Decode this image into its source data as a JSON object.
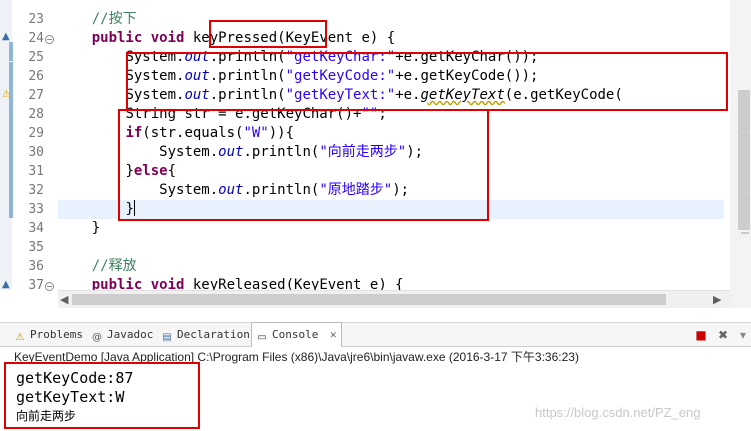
{
  "editor": {
    "line_numbers": [
      "23",
      "24",
      "25",
      "26",
      "27",
      "28",
      "29",
      "30",
      "31",
      "32",
      "33",
      "34",
      "35",
      "36",
      "37"
    ],
    "lines": [
      {
        "indent": "    ",
        "parts": [
          {
            "t": "//按下",
            "c": "cm"
          }
        ]
      },
      {
        "indent": "    ",
        "parts": [
          {
            "t": "public",
            "c": "kw"
          },
          {
            "t": " "
          },
          {
            "t": "void",
            "c": "kw"
          },
          {
            "t": " keyPressed(KeyEvent e) {"
          }
        ]
      },
      {
        "indent": "        ",
        "parts": [
          {
            "t": "System."
          },
          {
            "t": "out",
            "c": "it"
          },
          {
            "t": ".println("
          },
          {
            "t": "\"getKeyChar:\"",
            "c": "st"
          },
          {
            "t": "+e.getKeyChar());"
          }
        ]
      },
      {
        "indent": "        ",
        "parts": [
          {
            "t": "System."
          },
          {
            "t": "out",
            "c": "it"
          },
          {
            "t": ".println("
          },
          {
            "t": "\"getKeyCode:\"",
            "c": "st"
          },
          {
            "t": "+e.getKeyCode());"
          }
        ]
      },
      {
        "indent": "        ",
        "parts": [
          {
            "t": "System."
          },
          {
            "t": "out",
            "c": "it"
          },
          {
            "t": ".println("
          },
          {
            "t": "\"getKeyText:\"",
            "c": "st"
          },
          {
            "t": "+e."
          },
          {
            "t": "getKeyText",
            "c": "mi squig"
          },
          {
            "t": "(e.getKeyCode("
          }
        ]
      },
      {
        "indent": "        ",
        "parts": [
          {
            "t": "String str = e.getKeyChar()+"
          },
          {
            "t": "\"\"",
            "c": "st"
          },
          {
            "t": ";"
          }
        ]
      },
      {
        "indent": "        ",
        "parts": [
          {
            "t": "if",
            "c": "kw"
          },
          {
            "t": "(str.equals("
          },
          {
            "t": "\"W\"",
            "c": "st"
          },
          {
            "t": ")){"
          }
        ]
      },
      {
        "indent": "            ",
        "parts": [
          {
            "t": "System."
          },
          {
            "t": "out",
            "c": "it"
          },
          {
            "t": ".println("
          },
          {
            "t": "\"向前走两步\"",
            "c": "st"
          },
          {
            "t": ");"
          }
        ]
      },
      {
        "indent": "        ",
        "parts": [
          {
            "t": "}"
          },
          {
            "t": "else",
            "c": "kw"
          },
          {
            "t": "{"
          }
        ]
      },
      {
        "indent": "            ",
        "parts": [
          {
            "t": "System."
          },
          {
            "t": "out",
            "c": "it"
          },
          {
            "t": ".println("
          },
          {
            "t": "\"原地踏步\"",
            "c": "st"
          },
          {
            "t": ");"
          }
        ]
      },
      {
        "indent": "        ",
        "parts": [
          {
            "t": "}"
          }
        ],
        "caret": true
      },
      {
        "indent": "    ",
        "parts": [
          {
            "t": "}"
          }
        ]
      },
      {
        "indent": "",
        "parts": [
          {
            "t": ""
          }
        ]
      },
      {
        "indent": "    ",
        "parts": [
          {
            "t": "//释放",
            "c": "cm"
          }
        ]
      },
      {
        "indent": "    ",
        "parts": [
          {
            "t": "public",
            "c": "kw"
          },
          {
            "t": " "
          },
          {
            "t": "void",
            "c": "kw"
          },
          {
            "t": " keyReleased(KeyEvent e) {"
          }
        ]
      }
    ]
  },
  "tabs": [
    {
      "label": "Problems",
      "icon": "problems-icon",
      "glyph": "⚠",
      "color": "#c09000"
    },
    {
      "label": "Javadoc",
      "icon": "javadoc-icon",
      "glyph": "@",
      "color": "#555555"
    },
    {
      "label": "Declaration",
      "icon": "declaration-icon",
      "glyph": "▤",
      "color": "#4a6fa5"
    },
    {
      "label": "Console",
      "icon": "console-icon",
      "glyph": "▭",
      "color": "#333333",
      "active": true
    }
  ],
  "toolbar": {
    "terminate_glyph": "■",
    "terminate_color": "#cc0000",
    "remove_glyph": "✖",
    "remove_color": "#666666"
  },
  "console": {
    "launch_info": "KeyEventDemo [Java Application] C:\\Program Files (x86)\\Java\\jre6\\bin\\javaw.exe (2016-3-17 下午3:36:23)",
    "output": [
      "getKeyCode:87",
      "getKeyText:W",
      "向前走两步"
    ]
  },
  "watermark": "https://blog.csdn.net/PZ_eng",
  "colors": {
    "keyword": "#7f0055",
    "comment": "#3f7f5f",
    "string": "#2a00ff",
    "field": "#0000c0",
    "highlight_box": "#e00000",
    "current_line": "#e8f2fe"
  }
}
